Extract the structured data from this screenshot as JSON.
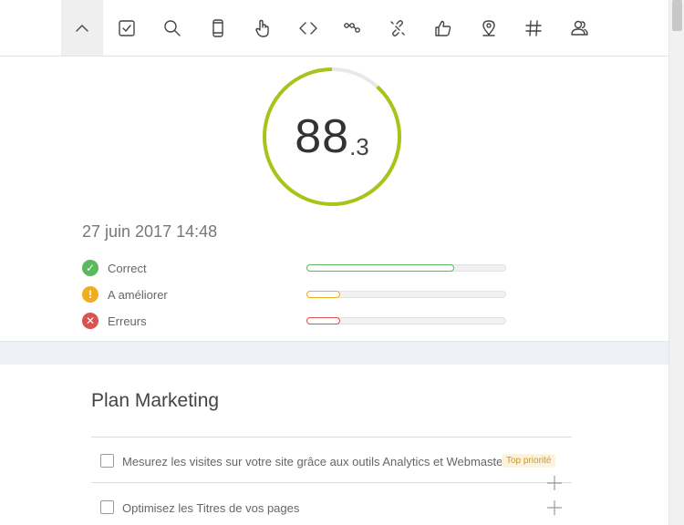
{
  "toolbar": {
    "items": [
      {
        "icon": "chevron-up-icon",
        "active": true
      },
      {
        "icon": "checkbox-icon",
        "active": false
      },
      {
        "icon": "search-icon",
        "active": false
      },
      {
        "icon": "mobile-icon",
        "active": false
      },
      {
        "icon": "hand-pointer-icon",
        "active": false
      },
      {
        "icon": "code-icon",
        "active": false
      },
      {
        "icon": "nodes-icon",
        "active": false
      },
      {
        "icon": "broken-link-icon",
        "active": false
      },
      {
        "icon": "thumbs-up-icon",
        "active": false
      },
      {
        "icon": "map-pin-icon",
        "active": false
      },
      {
        "icon": "hashtag-icon",
        "active": false
      },
      {
        "icon": "users-icon",
        "active": false
      }
    ]
  },
  "score": {
    "integer": "88",
    "decimal": ".3",
    "percent": 88.3,
    "ring_color": "#a8c41a",
    "track_color": "#e8e8e8"
  },
  "date": "27 juin 2017 14:48",
  "stats": [
    {
      "label": "Correct",
      "icon": "check-icon",
      "color": "#5cb85c",
      "fraction": 0.74
    },
    {
      "label": "A améliorer",
      "icon": "warning-icon",
      "color": "#f0ad1e",
      "fraction": 0.17
    },
    {
      "label": "Erreurs",
      "icon": "error-icon",
      "color": "#d9534f",
      "fraction": 0.17
    }
  ],
  "plan": {
    "title": "Plan Marketing",
    "tasks": [
      {
        "text": "Mesurez les visites sur votre site grâce aux outils Analytics et Webmaster",
        "badge": "Top priorité"
      },
      {
        "text": "Optimisez les Titres de vos pages",
        "badge": ""
      }
    ]
  }
}
